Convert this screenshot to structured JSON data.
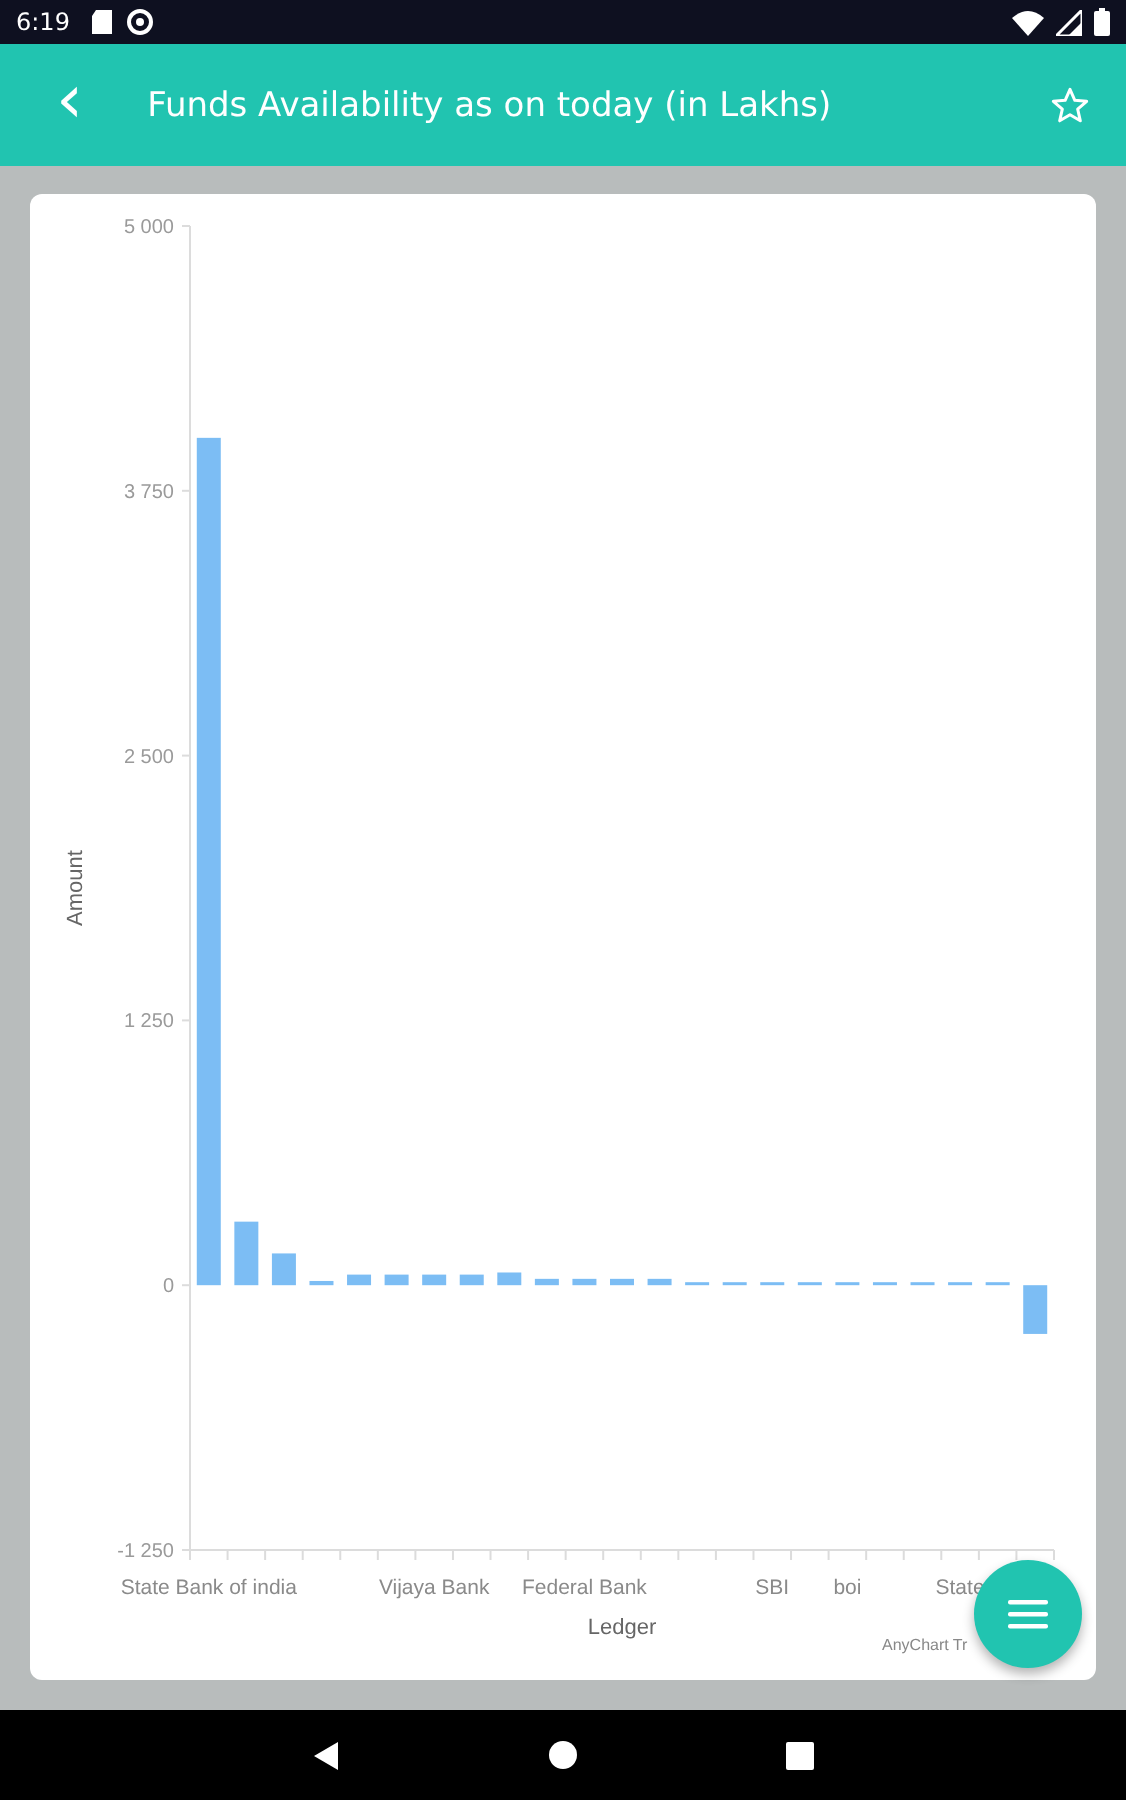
{
  "status_bar": {
    "time": "6:19"
  },
  "app_bar": {
    "back": "‹",
    "title": "Funds Availability as on today (in Lakhs)"
  },
  "chart": {
    "chart_data": {
      "type": "bar",
      "xlabel": "Ledger",
      "ylabel": "Amount",
      "categories": [
        "State Bank of india",
        null,
        null,
        null,
        null,
        null,
        "Vijaya Bank",
        null,
        null,
        null,
        "Federal Bank",
        null,
        null,
        null,
        null,
        "SBI",
        null,
        "boi",
        null,
        null,
        "State",
        null,
        null
      ],
      "series": [
        {
          "color": "#7cbdf4",
          "values": [
            4000,
            300,
            150,
            20,
            50,
            50,
            50,
            50,
            60,
            30,
            30,
            30,
            30,
            10,
            10,
            0,
            0,
            0,
            0,
            0,
            0,
            0,
            -230
          ]
        }
      ],
      "ylim": [
        -1250,
        5000
      ],
      "yticks": [
        {
          "value": 5000,
          "label": "5 000"
        },
        {
          "value": 3750,
          "label": "3 750"
        },
        {
          "value": 2500,
          "label": "2 500"
        },
        {
          "value": 1250,
          "label": "1 250"
        },
        {
          "value": 0,
          "label": "0"
        },
        {
          "value": -1250,
          "label": "-1 250"
        }
      ]
    },
    "credit": "AnyChart Tr"
  }
}
